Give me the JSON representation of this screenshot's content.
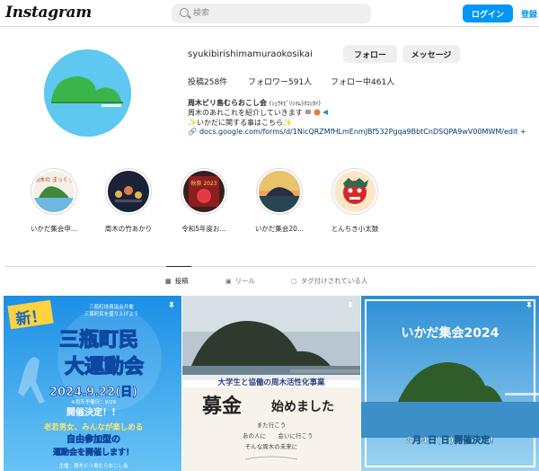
{
  "header": {
    "logo": "Instagram",
    "search_placeholder": "検索",
    "login_label": "ログイン",
    "signup_label": "登録"
  },
  "profile": {
    "username": "syukibirishimamuraokosikai",
    "follow_label": "フォロー",
    "message_label": "メッセージ",
    "stats": {
      "posts": "投稿258件",
      "followers": "フォロワー591人",
      "following": "フォロー中461人"
    },
    "full_name": "周木ビリ島むらおこし会",
    "full_name_kana": "(ｼｭｳｷﾋﾞﾘｼﾏﾑﾗｵｺｼｶｲ)",
    "bio_line1": "周木のあれこれを紹介していきます",
    "bio_line2": "いかだに関する事はこちら",
    "link": "docs.google.com/forms/d/1NicQRZMfHLmEnmJBf532Pgqa9BbtCnDSQPA9wV00MWM/edit +"
  },
  "highlights": [
    {
      "label": "いかだ集会申...",
      "pic_text": "周木の まっくろ"
    },
    {
      "label": "周木の竹あかり",
      "pic_text": ""
    },
    {
      "label": "令和5年度お...",
      "pic_text": "秋祭 2023"
    },
    {
      "label": "いかだ集会20...",
      "pic_text": ""
    },
    {
      "label": "とんちき小太鼓",
      "pic_text": ""
    }
  ],
  "tabs": [
    {
      "label": "投稿",
      "icon": "grid-icon"
    },
    {
      "label": "リール",
      "icon": "reel-icon"
    },
    {
      "label": "タグ付けされている人",
      "icon": "tag-icon"
    }
  ],
  "posts": [
    {
      "top_small": "三瓶町体育協会共催",
      "top_small2": "三瓶町民を盛り上げよう",
      "badge": "新！",
      "title1": "三瓶町民",
      "title2": "大運動会",
      "date": "2024.9.22(日)",
      "note": "※雨天予備日：9/29",
      "decided": "開催決定！！",
      "line1": "老若男女、みんなが楽しめる",
      "line2": "自由参加型の",
      "line3": "運動会を開催します！",
      "footer": "主催：周木ビリ島むらおこし会"
    },
    {
      "banner": "大学生と協働の周木活性化事業",
      "main1": "募金",
      "main2": "始めました",
      "sub1": "また行こう",
      "sub2": "あの人に",
      "sub2b": "会いに行こう",
      "sub3": "そんな周木の未来に"
    },
    {
      "title": "いかだ集会2024",
      "date": "8月4日(日)開催決定!"
    }
  ],
  "colors": {
    "accent": "#0095f6",
    "sky": "#5ec8f0",
    "island": "#3bb54a"
  }
}
